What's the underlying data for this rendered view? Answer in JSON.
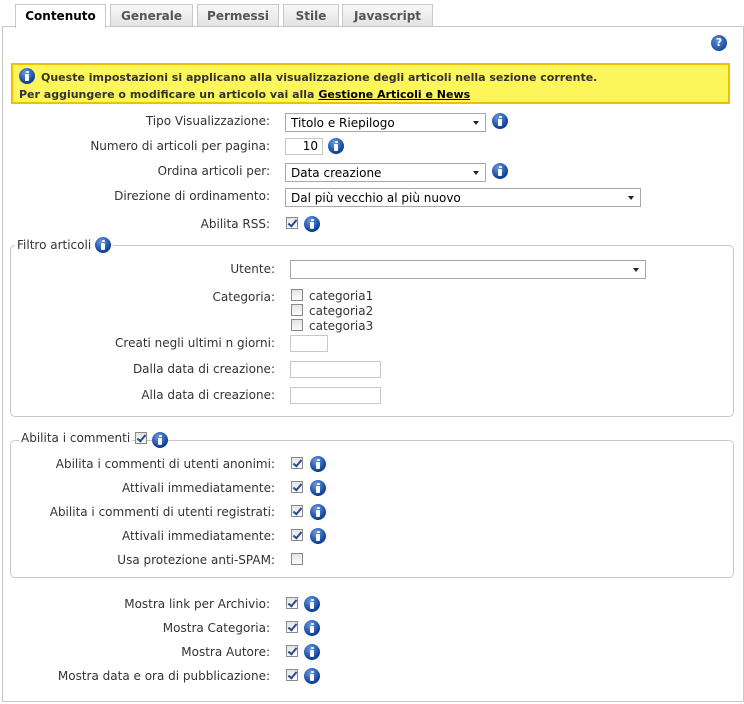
{
  "tabs": [
    {
      "label": "Contenuto",
      "active": true
    },
    {
      "label": "Generale",
      "active": false
    },
    {
      "label": "Permessi",
      "active": false
    },
    {
      "label": "Stile",
      "active": false
    },
    {
      "label": "Javascript",
      "active": false
    }
  ],
  "help_icon": "question-icon",
  "notice": {
    "line1": "Queste impostazioni si applicano alla visualizzazione degli articoli nella sezione corrente.",
    "line2_prefix": "Per aggiungere o modificare un articolo vai alla",
    "link": "Gestione Articoli e News",
    "colors": {
      "background": "#fdf65a",
      "border": "#f0c000"
    }
  },
  "settings": {
    "tipo_visualizzazione": {
      "label": "Tipo Visualizzazione:",
      "value": "Titolo e Riepilogo"
    },
    "numero_articoli": {
      "label": "Numero di articoli per pagina:",
      "value": "10"
    },
    "ordina_per": {
      "label": "Ordina articoli per:",
      "value": "Data creazione"
    },
    "direzione": {
      "label": "Direzione di ordinamento:",
      "value": "Dal più vecchio al più nuovo"
    },
    "abilita_rss": {
      "label": "Abilita RSS:",
      "checked": true
    }
  },
  "filtro": {
    "legend": "Filtro articoli",
    "utente": {
      "label": "Utente:",
      "value": ""
    },
    "categoria": {
      "label": "Categoria:",
      "options": [
        {
          "label": "categoria1",
          "checked": false
        },
        {
          "label": "categoria2",
          "checked": false
        },
        {
          "label": "categoria3",
          "checked": false
        }
      ]
    },
    "ultimi_giorni": {
      "label": "Creati negli ultimi n giorni:",
      "value": ""
    },
    "dalla_data": {
      "label": "Dalla data di creazione:",
      "value": ""
    },
    "alla_data": {
      "label": "Alla data di creazione:",
      "value": ""
    }
  },
  "commenti": {
    "legend": "Abilita i commenti",
    "checked": true,
    "items": [
      {
        "label": "Abilita i commenti di utenti anonimi:",
        "checked": true,
        "info": true
      },
      {
        "label": "Attivali immediatamente:",
        "checked": true,
        "info": true
      },
      {
        "label": "Abilita i commenti di utenti registrati:",
        "checked": true,
        "info": true
      },
      {
        "label": "Attivali immediatamente:",
        "checked": true,
        "info": true
      },
      {
        "label": "Usa protezione anti-SPAM:",
        "checked": false,
        "info": false
      }
    ]
  },
  "mostra": [
    {
      "label": "Mostra link per Archivio:",
      "checked": true
    },
    {
      "label": "Mostra Categoria:",
      "checked": true
    },
    {
      "label": "Mostra Autore:",
      "checked": true
    },
    {
      "label": "Mostra data e ora di pubblicazione:",
      "checked": true
    }
  ]
}
